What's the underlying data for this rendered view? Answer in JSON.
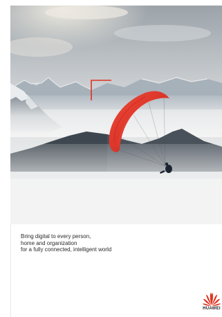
{
  "cover": {
    "tagline_lines": [
      "Bring digital to every person,",
      "home and organization",
      "for a fully connected, intelligent world"
    ],
    "brand": "HUAWEI"
  },
  "colors": {
    "accent_red": "#e0301e",
    "background": "#ffffff"
  },
  "icons": {
    "logo": "huawei-petal-logo",
    "frame_marker": "corner-bracket"
  }
}
